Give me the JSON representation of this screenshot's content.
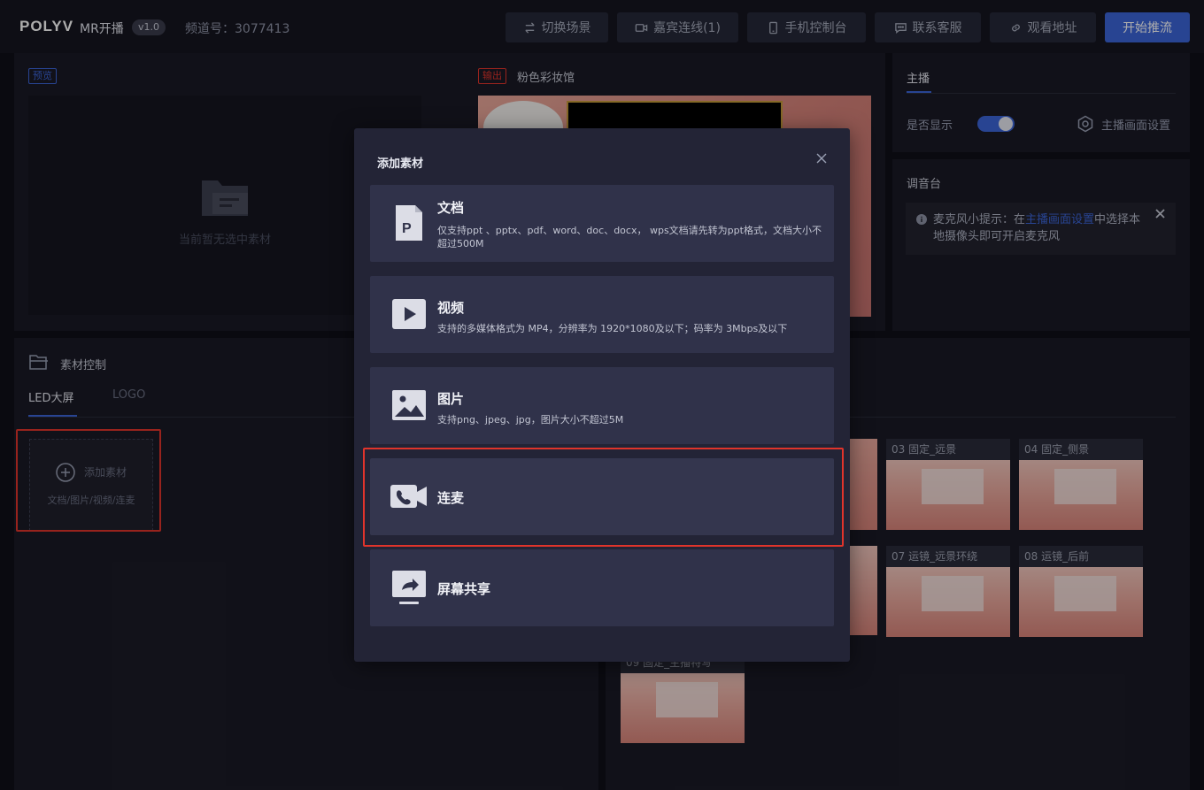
{
  "header": {
    "logo": "POLYV",
    "product": "MR开播",
    "version": "v1.0",
    "channel": "频道号：3077413",
    "buttons": [
      {
        "label": "切换场景",
        "icon": "swap-icon"
      },
      {
        "label": "嘉宾连线(1)",
        "icon": "video-camera-icon"
      },
      {
        "label": "手机控制台",
        "icon": "phone-icon"
      },
      {
        "label": "联系客服",
        "icon": "chat-icon"
      },
      {
        "label": "观看地址",
        "icon": "link-icon"
      }
    ],
    "start_label": "开始推流"
  },
  "preview": {
    "tag": "预览",
    "empty_text": "当前暂无选中素材"
  },
  "output": {
    "tag": "输出",
    "title": "粉色彩妆馆"
  },
  "host": {
    "tab": "主播",
    "show_label": "是否显示",
    "show_on": true,
    "settings_label": "主播画面设置"
  },
  "mixer": {
    "title": "调音台",
    "tip_prefix": "麦克风小提示：在",
    "tip_link": "主播画面设置",
    "tip_suffix": "中选择本地摄像头即可开启麦克风"
  },
  "material": {
    "title": "素材控制",
    "tabs": [
      "LED大屏",
      "LOGO"
    ],
    "active_tab": 0,
    "add_title": "添加素材",
    "add_sub": "文档/图片/视频/连麦"
  },
  "scenes": [
    {
      "label": "03 固定_远景"
    },
    {
      "label": "04 固定_侧景"
    },
    {
      "label": "07 运镜_远景环绕"
    },
    {
      "label": "08 运镜_后前"
    },
    {
      "label": "09 固定_主播特写"
    }
  ],
  "modal": {
    "title": "添加素材",
    "options": [
      {
        "title": "文档",
        "desc": "仅支持ppt 、pptx、pdf、word、doc、docx， wps文档请先转为ppt格式，文档大小不超过500M",
        "icon": "document-p-icon"
      },
      {
        "title": "视频",
        "desc": "支持的多媒体格式为 MP4，分辨率为 1920*1080及以下；码率为 3Mbps及以下",
        "icon": "video-play-icon"
      },
      {
        "title": "图片",
        "desc": "支持png、jpeg、jpg，图片大小不超过5M",
        "icon": "image-icon"
      },
      {
        "title": "连麦",
        "desc": "",
        "icon": "video-call-icon"
      },
      {
        "title": "屏幕共享",
        "desc": "",
        "icon": "screen-share-icon"
      }
    ]
  },
  "colors": {
    "accent": "#3c65d8",
    "highlight": "#e0342b",
    "modal_bg": "#232436",
    "option_bg": "#30324a"
  }
}
